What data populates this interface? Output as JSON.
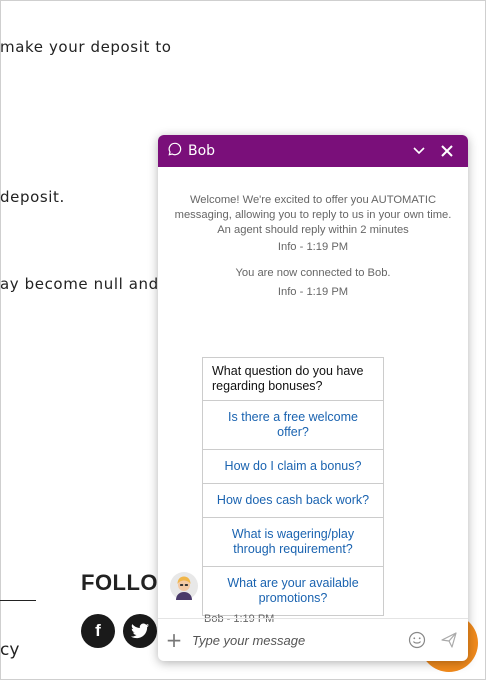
{
  "background": {
    "line1": "make your deposit to",
    "line2": "deposit.",
    "line3": "ay become null and",
    "follow_title": "FOLLOW",
    "footer_text": "cy",
    "social": {
      "facebook": "f",
      "twitter": "twitter-icon"
    }
  },
  "chat": {
    "header_title": "Bob",
    "welcome": "Welcome! We're excited to offer you AUTOMATIC messaging, allowing you to reply to us in your own time. An agent should reply within 2 minutes",
    "welcome_time": "Info - 1:19 PM",
    "connected": "You are now connected to Bob.",
    "connected_time": "Info - 1:19 PM",
    "question": "What question do you have regarding bonuses?",
    "options": [
      "Is there a free welcome offer?",
      "How do I claim a bonus?",
      "How does cash back work?",
      "What is wagering/play through requirement?",
      "What are your available promotions?"
    ],
    "bot_time": "Bob - 1:19 PM",
    "input_placeholder": "Type your message",
    "colors": {
      "header": "#7a0f7a",
      "link": "#1a63b0",
      "fab": "#f08a1c"
    }
  }
}
